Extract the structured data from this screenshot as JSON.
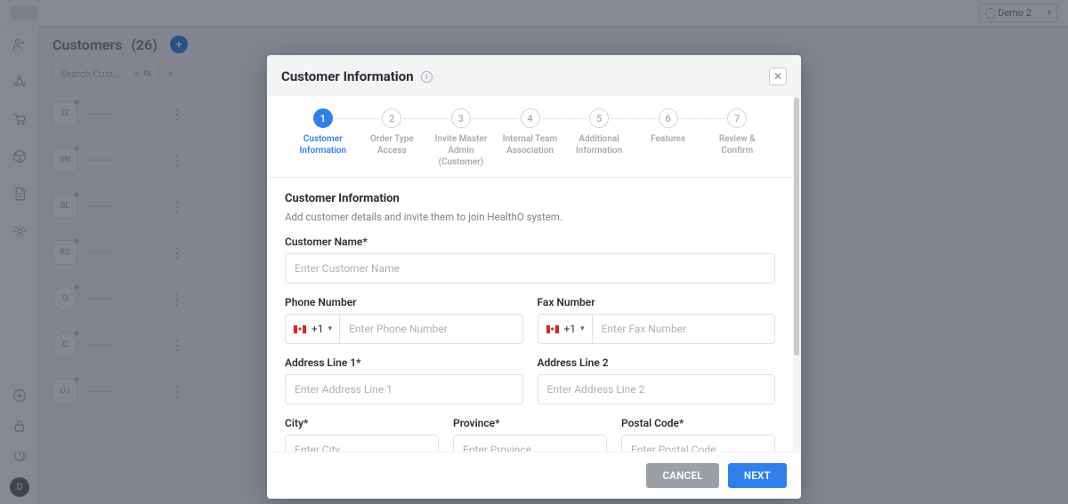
{
  "topbar": {
    "demo_label": "Demo 2"
  },
  "sidebar": {
    "header_title": "Customers",
    "header_count": "(26)",
    "search_placeholder": "Search Customer"
  },
  "list": {
    "items": [
      {
        "badge": "JZ",
        "shape": "sq"
      },
      {
        "badge": "SN",
        "shape": "sq"
      },
      {
        "badge": "BL",
        "shape": "sq"
      },
      {
        "badge": "BS",
        "shape": "sq"
      },
      {
        "badge": "Q",
        "shape": "circ"
      },
      {
        "badge": "C",
        "shape": "circ"
      },
      {
        "badge": "UJ",
        "shape": "sq"
      }
    ]
  },
  "rail_avatar": "D",
  "modal": {
    "title": "Customer Information",
    "steps": [
      {
        "num": "1",
        "label": "Customer Information"
      },
      {
        "num": "2",
        "label": "Order Type Access"
      },
      {
        "num": "3",
        "label": "Invite Master Admin (Customer)"
      },
      {
        "num": "4",
        "label": "Internal Team Association"
      },
      {
        "num": "5",
        "label": "Additional Information"
      },
      {
        "num": "6",
        "label": "Features"
      },
      {
        "num": "7",
        "label": "Review & Confirm"
      }
    ],
    "section_title": "Customer Information",
    "section_sub": "Add customer details and invite them to join HealthO system.",
    "labels": {
      "customer_name": "Customer Name*",
      "phone": "Phone Number",
      "fax": "Fax Number",
      "addr1": "Address Line 1*",
      "addr2": "Address Line 2",
      "city": "City*",
      "province": "Province*",
      "postal": "Postal Code*"
    },
    "placeholders": {
      "customer_name": "Enter Customer Name",
      "phone": "Enter Phone Number",
      "fax": "Enter Fax Number",
      "addr1": "Enter Address Line 1",
      "addr2": "Enter Address Line 2",
      "city": "Enter City",
      "province": "Enter Province",
      "postal": "Enter Postal Code"
    },
    "country_code": "+1",
    "buttons": {
      "cancel": "CANCEL",
      "next": "NEXT"
    }
  }
}
